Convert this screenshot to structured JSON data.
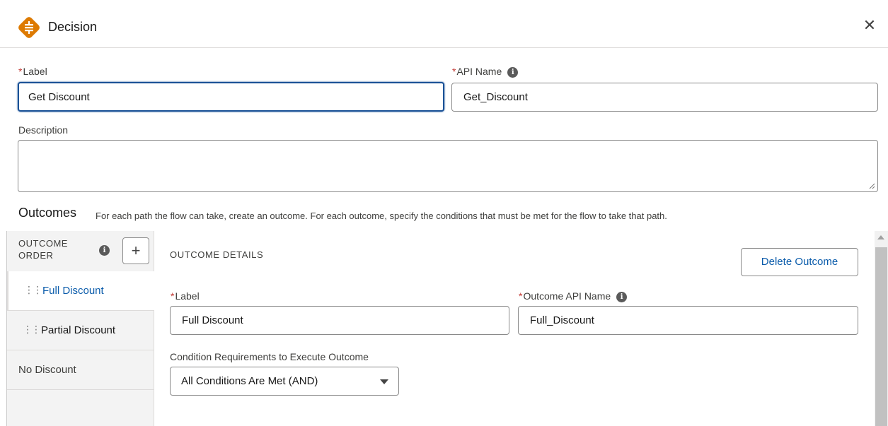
{
  "header": {
    "title": "Decision",
    "close_glyph": "✕",
    "icon": "decision-icon",
    "icon_color": "#dd7a01"
  },
  "form": {
    "label": {
      "label": "Label",
      "value": "Get Discount"
    },
    "api_name": {
      "label": "API Name",
      "value": "Get_Discount"
    },
    "description": {
      "label": "Description",
      "value": ""
    },
    "required_mark": "*",
    "info_glyph": "i"
  },
  "outcomes": {
    "title": "Outcomes",
    "description": "For each path the flow can take, create an outcome. For each outcome, specify the conditions that must be met for the flow to take that path.",
    "order_label": "OUTCOME ORDER",
    "add_glyph": "+",
    "items": [
      {
        "label": "Full Discount",
        "active": true
      },
      {
        "label": "Partial Discount",
        "active": false
      },
      {
        "label": "No Discount",
        "active": false
      }
    ]
  },
  "details": {
    "title": "OUTCOME DETAILS",
    "delete_label": "Delete Outcome",
    "label": {
      "label": "Label",
      "value": "Full Discount"
    },
    "api_name": {
      "label": "Outcome API Name",
      "value": "Full_Discount"
    },
    "condition": {
      "label": "Condition Requirements to Execute Outcome",
      "value": "All Conditions Are Met (AND)"
    }
  },
  "colors": {
    "accent": "#0b5cab",
    "focus": "#1b5297",
    "required": "#c23934"
  }
}
